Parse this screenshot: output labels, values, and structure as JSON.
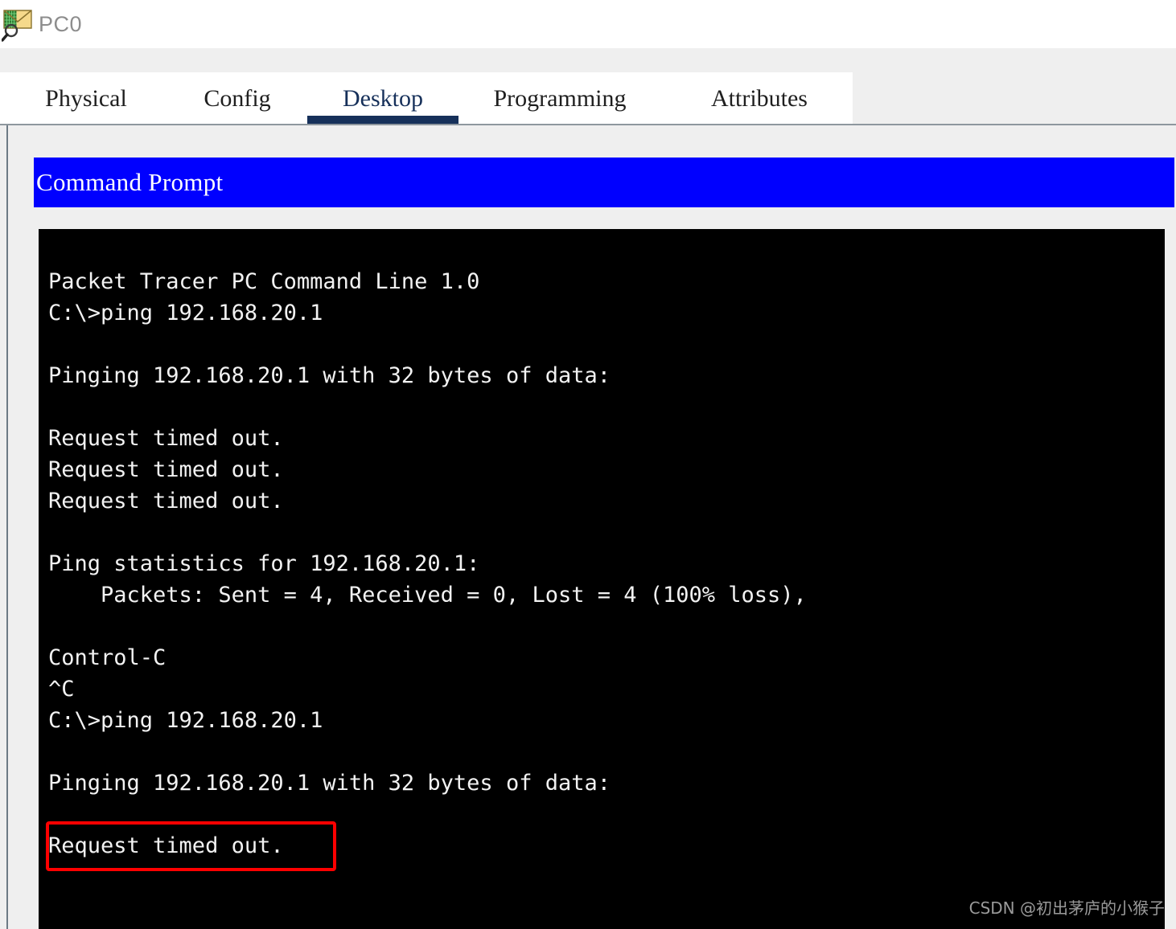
{
  "window": {
    "title": "PC0",
    "icon": "packet-tracer-pc-icon"
  },
  "tabs": [
    {
      "label": "Physical",
      "active": false
    },
    {
      "label": "Config",
      "active": false
    },
    {
      "label": "Desktop",
      "active": true
    },
    {
      "label": "Programming",
      "active": false
    },
    {
      "label": "Attributes",
      "active": false
    }
  ],
  "command_prompt": {
    "header_label": "Command Prompt",
    "header_color": "#0000ff",
    "background_color": "#000000",
    "text_color": "#f2f2f2",
    "lines": [
      "Packet Tracer PC Command Line 1.0",
      "C:\\>ping 192.168.20.1",
      "",
      "Pinging 192.168.20.1 with 32 bytes of data:",
      "",
      "Request timed out.",
      "Request timed out.",
      "Request timed out.",
      "",
      "Ping statistics for 192.168.20.1:",
      "    Packets: Sent = 4, Received = 0, Lost = 4 (100% loss),",
      "",
      "Control-C",
      "^C",
      "C:\\>ping 192.168.20.1",
      "",
      "Pinging 192.168.20.1 with 32 bytes of data:",
      "",
      "Request timed out."
    ]
  },
  "annotation": {
    "name": "red-highlight-box",
    "color": "#fe0000",
    "target_text": "Request timed out."
  },
  "watermark": {
    "text": "CSDN @初出茅庐的小猴子"
  },
  "colors": {
    "accent_navy": "#16305a",
    "panel_gray": "#efefef",
    "border_gray": "#6d7a85"
  }
}
